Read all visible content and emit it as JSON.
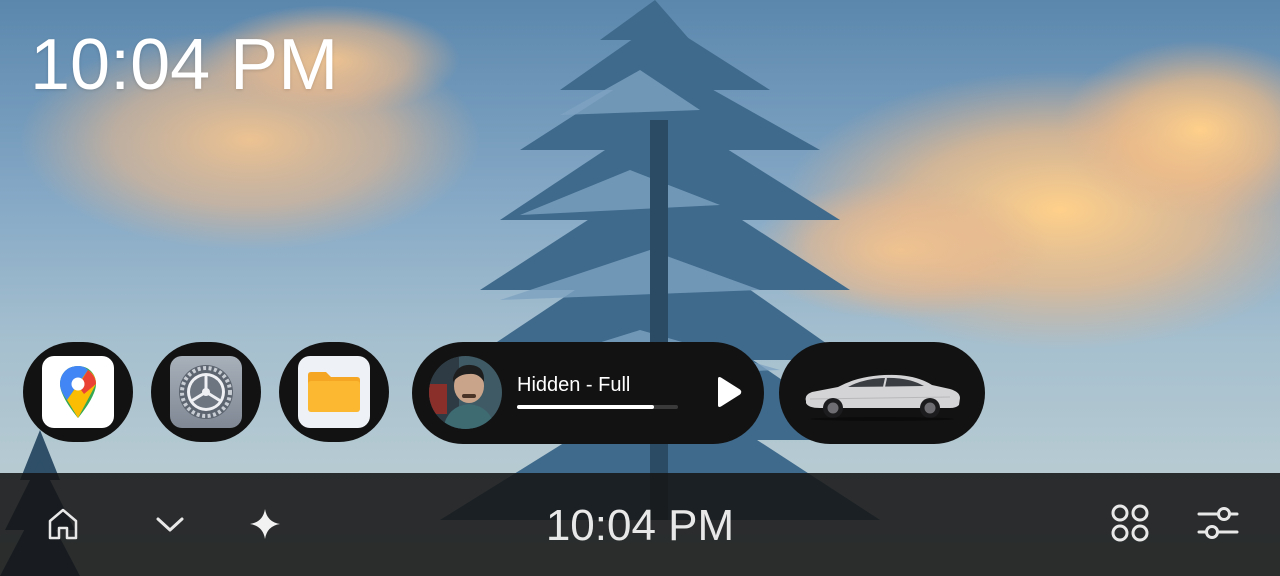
{
  "status": {
    "time": "10:04 PM"
  },
  "dock": {
    "apps": [
      {
        "name": "Maps",
        "icon": "google-maps-icon"
      },
      {
        "name": "Settings",
        "icon": "settings-gear-icon"
      },
      {
        "name": "Files",
        "icon": "folder-icon"
      }
    ],
    "media": {
      "title": "Hidden - Full",
      "progress": 0.85,
      "play_icon": "play-icon",
      "art_icon": "album-art-avatar"
    },
    "vehicle": {
      "icon": "car-icon",
      "color": "#d4d4d6"
    }
  },
  "taskbar": {
    "home_icon": "home-icon",
    "collapse_icon": "chevron-down-icon",
    "assistant_icon": "sparkle-icon",
    "time": "10:04 PM",
    "apps_icon": "app-grid-icon",
    "settings_icon": "sliders-icon"
  },
  "colors": {
    "pill_bg": "#121212",
    "bar_bg": "#161616",
    "folder": "#fbb830",
    "text": "#ffffff"
  }
}
